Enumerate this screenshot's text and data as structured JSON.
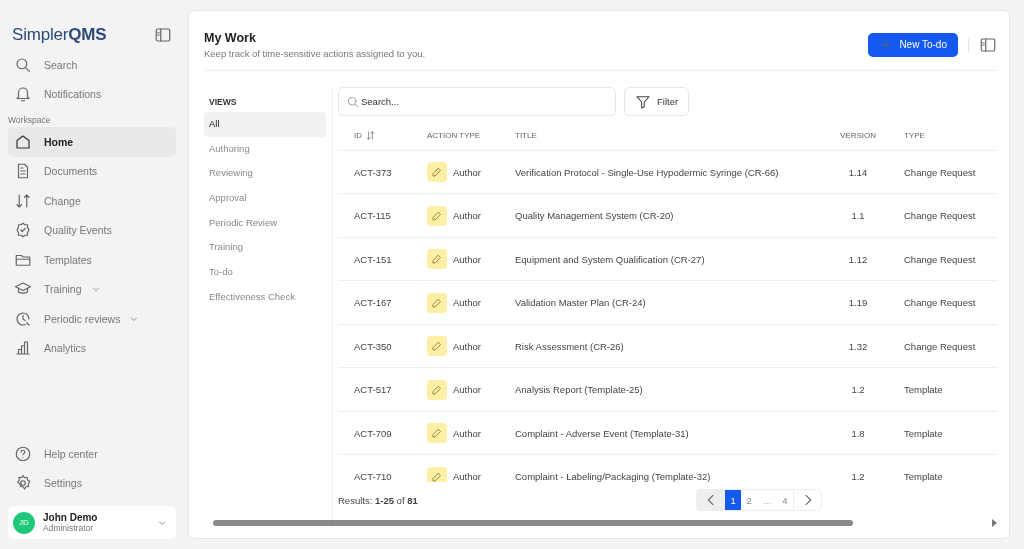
{
  "brand": {
    "part1": "Simpler",
    "part2": "QMS"
  },
  "sidebar": {
    "top_items": [
      {
        "label": "Search",
        "selected": false
      },
      {
        "label": "Notifications",
        "selected": false
      }
    ],
    "section_label": "Workspace",
    "items": [
      {
        "label": "Home",
        "selected": true,
        "expandable": false
      },
      {
        "label": "Documents",
        "selected": false,
        "expandable": false
      },
      {
        "label": "Change",
        "selected": false,
        "expandable": false
      },
      {
        "label": "Quality Events",
        "selected": false,
        "expandable": false
      },
      {
        "label": "Templates",
        "selected": false,
        "expandable": false
      },
      {
        "label": "Training",
        "selected": false,
        "expandable": true
      },
      {
        "label": "Periodic reviews",
        "selected": false,
        "expandable": true
      },
      {
        "label": "Analytics",
        "selected": false,
        "expandable": false
      }
    ],
    "bottom_items": [
      {
        "label": "Help center",
        "selected": false
      },
      {
        "label": "Settings",
        "selected": false
      }
    ],
    "user": {
      "initials": "JD",
      "name": "John Demo",
      "role": "Administrator"
    }
  },
  "page": {
    "title": "My Work",
    "subtitle": "Keep track of time-sensitive actions assigned to you.",
    "primary_button": "New To-do"
  },
  "views": {
    "heading": "VIEWS",
    "items": [
      {
        "label": "All",
        "selected": true
      },
      {
        "label": "Authoring",
        "selected": false
      },
      {
        "label": "Reviewing",
        "selected": false
      },
      {
        "label": "Approval",
        "selected": false
      },
      {
        "label": "Periodic Review",
        "selected": false
      },
      {
        "label": "Training",
        "selected": false
      },
      {
        "label": "To-do",
        "selected": false
      },
      {
        "label": "Effectiveness Check",
        "selected": false
      }
    ]
  },
  "search": {
    "placeholder": "Search..."
  },
  "filter_button": "Filter",
  "table": {
    "columns": [
      "ID",
      "ACTION TYPE",
      "TITLE",
      "VERSION",
      "TYPE"
    ],
    "rows": [
      {
        "id": "ACT-373",
        "action": "Author",
        "title": "Verification Protocol - Single-Use Hypodermic Syringe (CR-66)",
        "version": "1.14",
        "type": "Change Request"
      },
      {
        "id": "ACT-115",
        "action": "Author",
        "title": "Quality Management System (CR-20)",
        "version": "1.1",
        "type": "Change Request"
      },
      {
        "id": "ACT-151",
        "action": "Author",
        "title": "Equipment and System Qualification (CR-27)",
        "version": "1.12",
        "type": "Change Request"
      },
      {
        "id": "ACT-167",
        "action": "Author",
        "title": "Validation Master Plan (CR-24)",
        "version": "1.19",
        "type": "Change Request"
      },
      {
        "id": "ACT-350",
        "action": "Author",
        "title": "Risk Assessment (CR-26)",
        "version": "1.32",
        "type": "Change Request"
      },
      {
        "id": "ACT-517",
        "action": "Author",
        "title": "Analysis Report (Template-25)",
        "version": "1.2",
        "type": "Template"
      },
      {
        "id": "ACT-709",
        "action": "Author",
        "title": "Complaint - Adverse Event (Template-31)",
        "version": "1.8",
        "type": "Template"
      },
      {
        "id": "ACT-710",
        "action": "Author",
        "title": "Complaint - Labeling/Packaging (Template-32)",
        "version": "1.2",
        "type": "Template"
      }
    ]
  },
  "results": "Results: **1-25** of **81**",
  "pagination": [
    {
      "label": "1",
      "selected": true,
      "kind": "page"
    },
    {
      "label": "2",
      "selected": false,
      "kind": "page"
    },
    {
      "label": "...",
      "kind": "gap"
    },
    {
      "label": "4",
      "selected": false,
      "kind": "page"
    }
  ]
}
